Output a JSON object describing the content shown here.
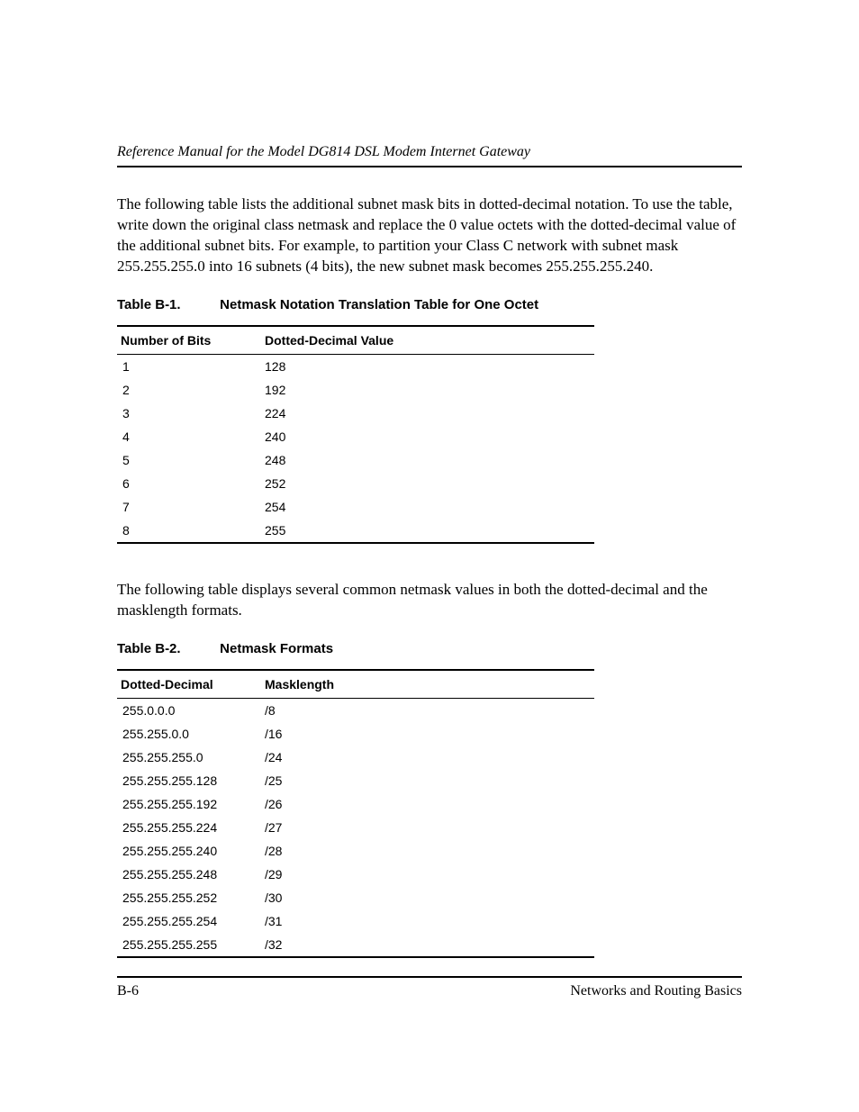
{
  "header": {
    "title": "Reference Manual for the Model DG814 DSL Modem Internet Gateway"
  },
  "para1": "The following table lists the additional subnet mask bits in dotted-decimal notation. To use the table, write down the original class netmask and replace the 0 value octets with the dotted-decimal value of the additional subnet bits. For example, to partition your Class C network with subnet mask 255.255.255.0 into 16 subnets (4 bits), the new subnet mask becomes 255.255.255.240.",
  "table1": {
    "caption_label": "Table B-1.",
    "caption_title": "Netmask Notation Translation Table for One Octet",
    "headers": [
      "Number of Bits",
      "Dotted-Decimal Value"
    ],
    "rows": [
      [
        "1",
        "128"
      ],
      [
        "2",
        "192"
      ],
      [
        "3",
        "224"
      ],
      [
        "4",
        "240"
      ],
      [
        "5",
        "248"
      ],
      [
        "6",
        "252"
      ],
      [
        "7",
        "254"
      ],
      [
        "8",
        "255"
      ]
    ]
  },
  "para2": "The following table displays several common netmask values in both the dotted-decimal and the masklength formats.",
  "table2": {
    "caption_label": "Table B-2.",
    "caption_title": "Netmask Formats",
    "headers": [
      "Dotted-Decimal",
      "Masklength"
    ],
    "rows": [
      [
        "255.0.0.0",
        "/8"
      ],
      [
        "255.255.0.0",
        "/16"
      ],
      [
        "255.255.255.0",
        "/24"
      ],
      [
        "255.255.255.128",
        "/25"
      ],
      [
        "255.255.255.192",
        "/26"
      ],
      [
        "255.255.255.224",
        "/27"
      ],
      [
        "255.255.255.240",
        "/28"
      ],
      [
        "255.255.255.248",
        "/29"
      ],
      [
        "255.255.255.252",
        "/30"
      ],
      [
        "255.255.255.254",
        "/31"
      ],
      [
        "255.255.255.255",
        "/32"
      ]
    ]
  },
  "footer": {
    "page": "B-6",
    "section": "Networks and Routing Basics"
  }
}
